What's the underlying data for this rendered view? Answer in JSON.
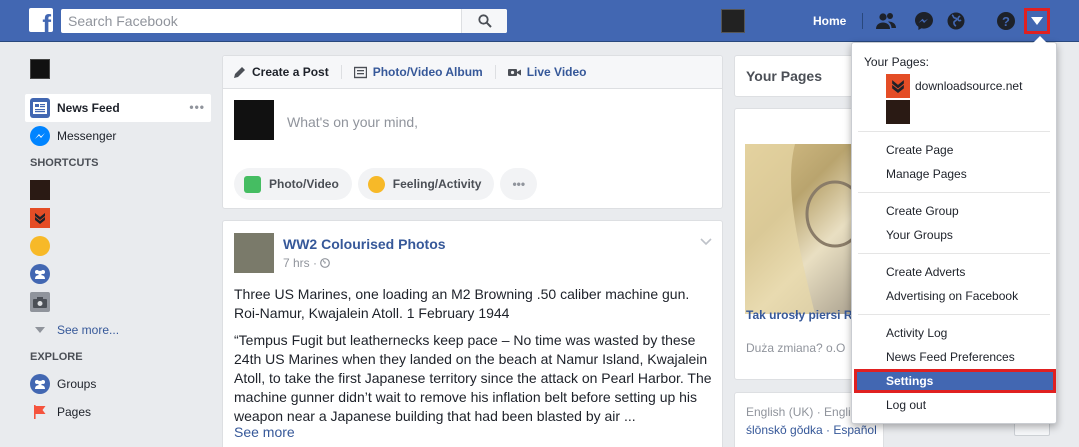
{
  "topbar": {
    "logo_letter": "f",
    "search_placeholder": "Search Facebook",
    "home_label": "Home"
  },
  "left_nav": {
    "items": [
      {
        "label": "News Feed"
      },
      {
        "label": "Messenger"
      }
    ],
    "more_dots": "•••",
    "shortcuts_header": "SHORTCUTS",
    "see_more": "See more...",
    "explore_header": "EXPLORE",
    "explore_items": [
      {
        "label": "Groups"
      },
      {
        "label": "Pages"
      }
    ]
  },
  "composer": {
    "tabs": [
      "Create a Post",
      "Photo/Video Album",
      "Live Video"
    ],
    "placeholder": "What's on your mind,",
    "actions": [
      "Photo/Video",
      "Feeling/Activity"
    ],
    "more": "•••"
  },
  "post": {
    "author": "WW2 Colourised Photos",
    "time": "7 hrs · ",
    "paragraph1": "Three US Marines, one loading an M2 Browning .50 caliber machine gun. Roi-Namur, Kwajalein Atoll. 1 February 1944",
    "paragraph2": "“Tempus Fugit but leathernecks keep pace – No time was wasted by these 24th US Marines when they landed on the beach at Namur Island, Kwajalein Atoll, to take the first Japanese territory since the attack on Pearl Harbor. The machine gunner didn’t wait to remove his inflation belt before setting up his weapon near a Japanese building that had been blasted by air ...",
    "see_more": "See more"
  },
  "right_column": {
    "your_pages": "Your Pages",
    "ad_title": "Tak urosły piersi R",
    "ad_sub": "Duża zmiana? o.O",
    "lang_line1": "English (UK) · Engli",
    "lang_line2": "ślōnskŏ gŏdka · Español"
  },
  "menu": {
    "your_pages_title": "Your Pages:",
    "pages": [
      {
        "name": "downloadsource.net"
      },
      {
        "name": ""
      }
    ],
    "groups": [
      [
        "Create Page",
        "Manage Pages"
      ],
      [
        "Create Group",
        "Your Groups"
      ],
      [
        "Create Adverts",
        "Advertising on Facebook"
      ],
      [
        "Activity Log",
        "News Feed Preferences",
        "Settings",
        "Log out"
      ]
    ],
    "highlighted": "Settings"
  },
  "colors": {
    "brand_blue": "#4267b2",
    "link_blue": "#365899",
    "highlight_red": "#e02020",
    "background": "#e9ebee"
  }
}
